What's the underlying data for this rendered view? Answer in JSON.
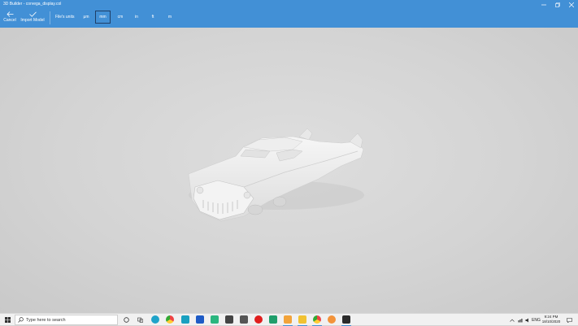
{
  "window": {
    "title": "3D Builder - corvega_display.col",
    "controls": [
      "minimize-icon",
      "restore-icon",
      "close-icon"
    ]
  },
  "commands": {
    "cancel_label": "Cancel",
    "import_label": "Import Model",
    "units_label": "File's units"
  },
  "units": [
    {
      "label": "μm",
      "selected": false
    },
    {
      "label": "mm",
      "selected": true
    },
    {
      "label": "cm",
      "selected": false
    },
    {
      "label": "in",
      "selected": false
    },
    {
      "label": "ft",
      "selected": false
    },
    {
      "label": "m",
      "selected": false
    }
  ],
  "taskbar": {
    "search_placeholder": "Type here to search",
    "pinned_apps": [
      "task-view",
      "edge",
      "chrome",
      "store",
      "maxthon",
      "excel-like",
      "calculator",
      "paint",
      "recorder",
      "app-a",
      "app-n",
      "file-explorer",
      "chrome-2",
      "app-orange",
      "3d-builder"
    ],
    "tray_lang": "ENG",
    "time": "9:24 PM",
    "date": "18/10/2020"
  },
  "colors": {
    "accent": "#4290d6",
    "viewport": "#d4d4d4",
    "model": "#f2f2f2"
  }
}
